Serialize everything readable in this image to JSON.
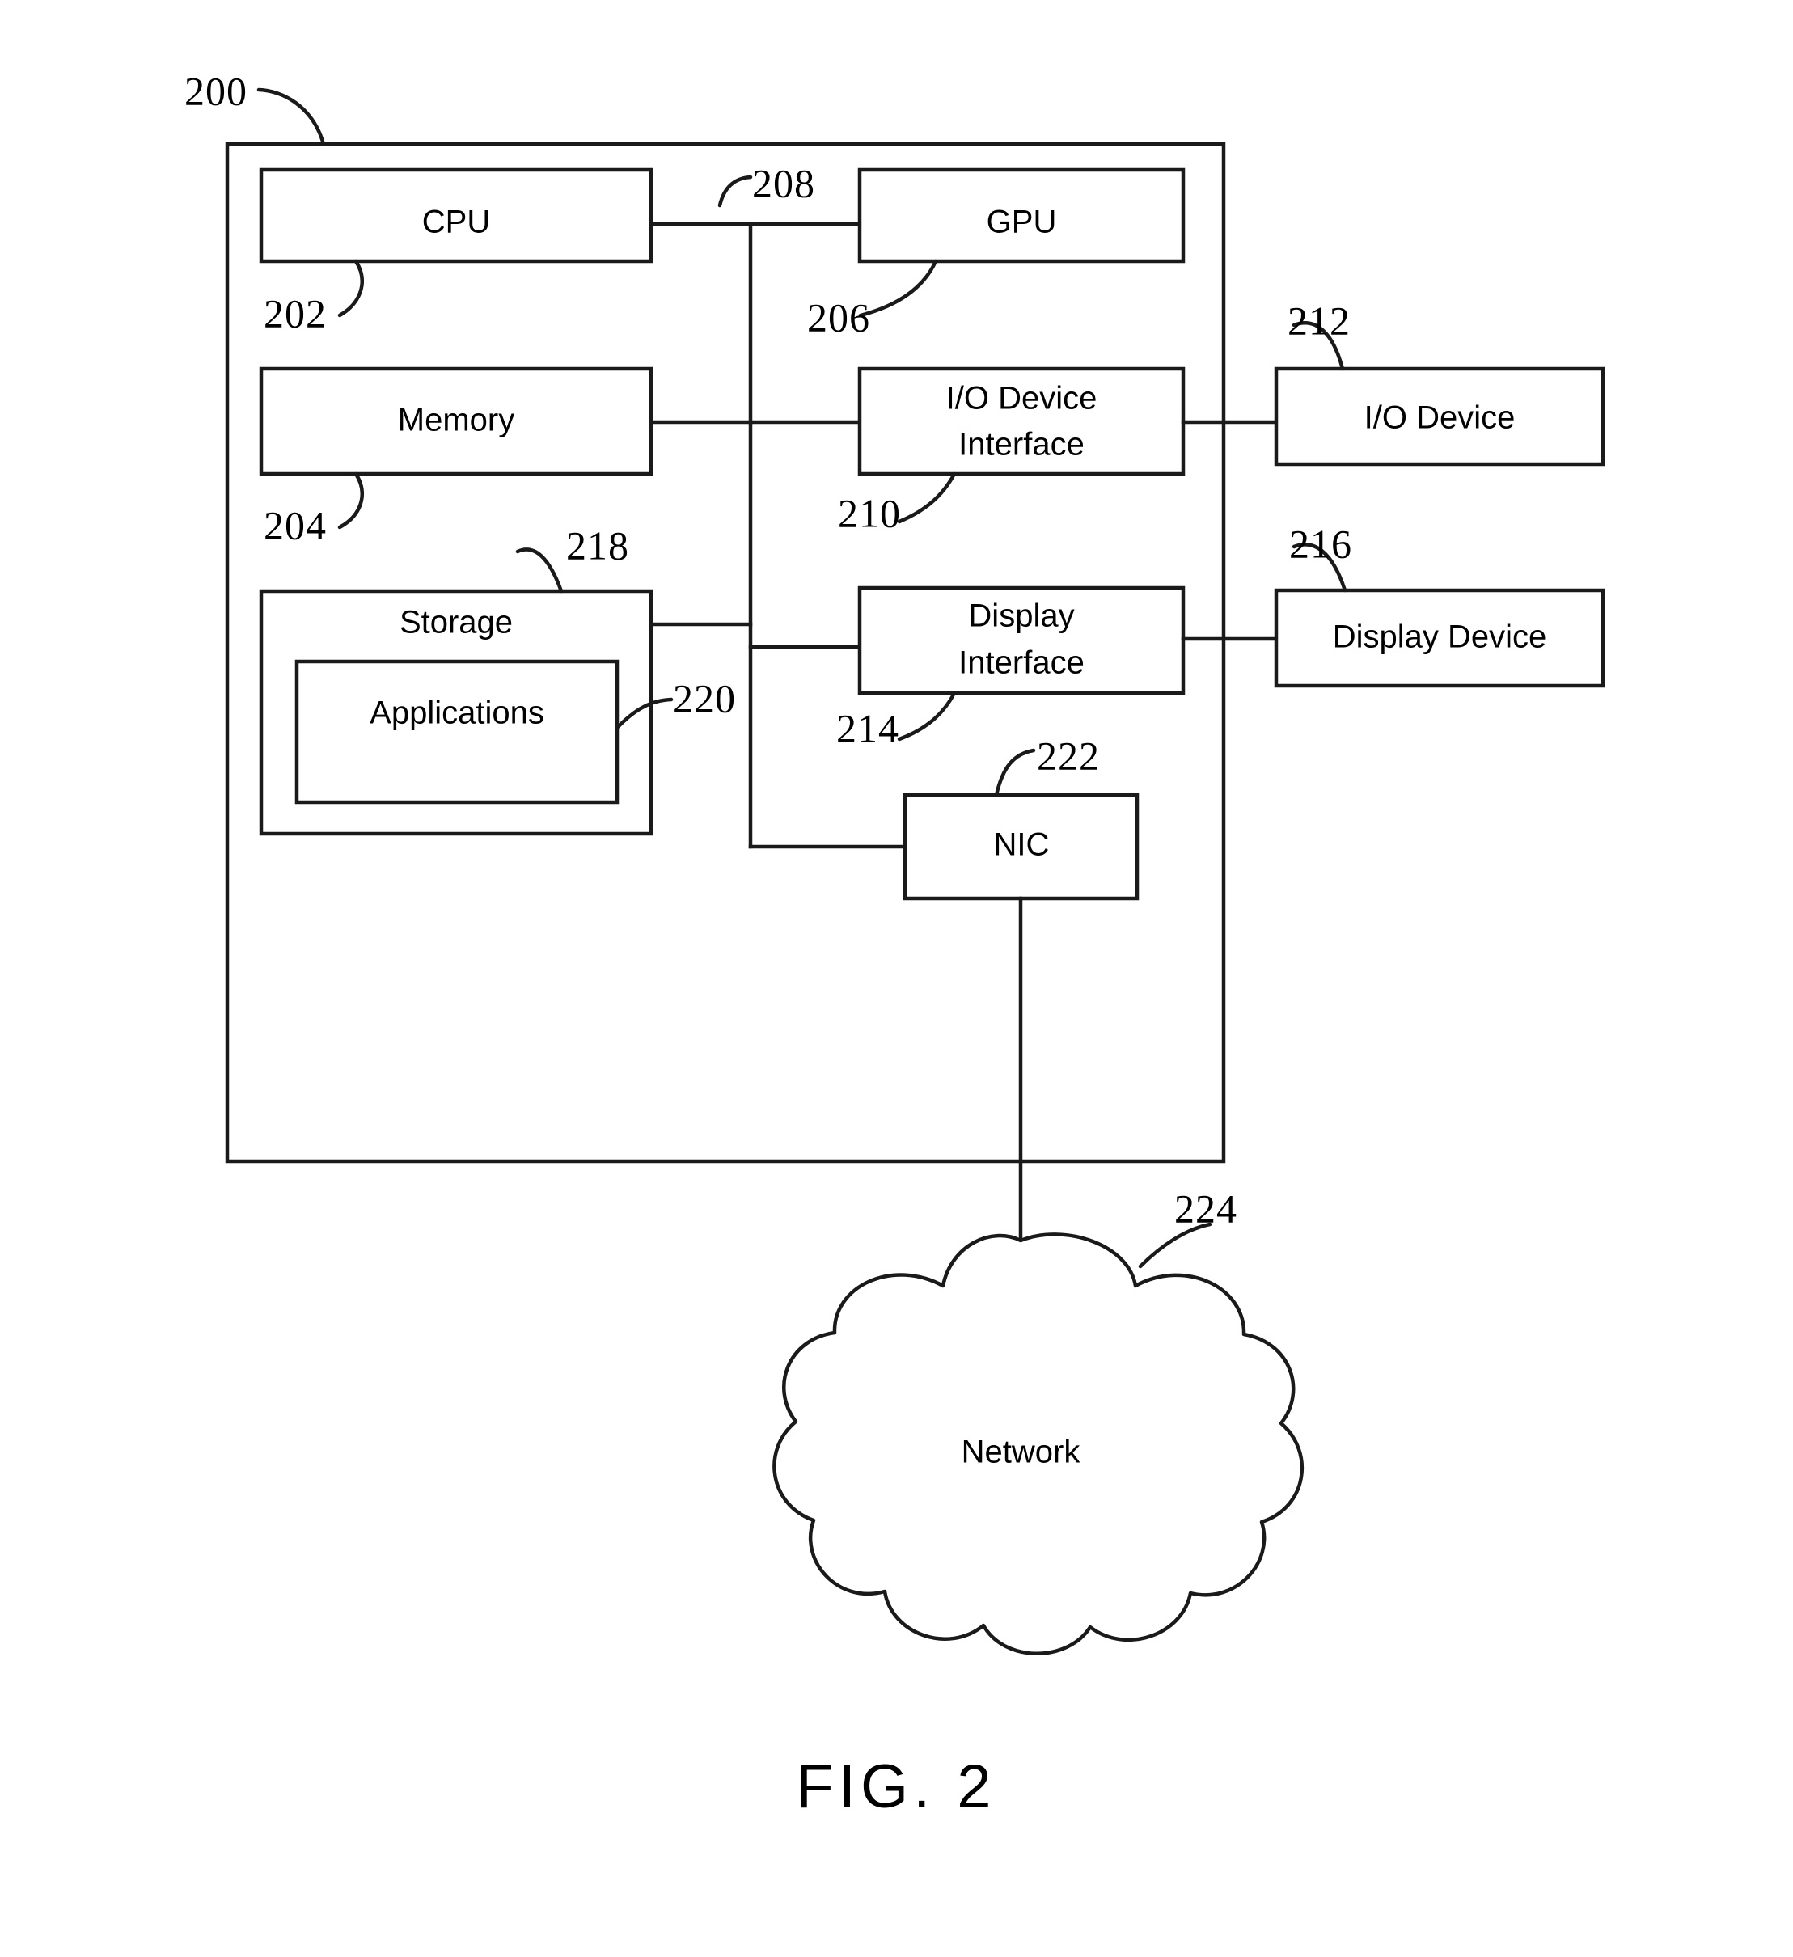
{
  "figure": {
    "caption": "FIG. 2",
    "system_ref": "200"
  },
  "nodes": [
    {
      "id": "cpu",
      "label": "CPU",
      "ref": "202",
      "line1": "CPU",
      "line2": ""
    },
    {
      "id": "gpu",
      "label": "GPU",
      "ref": "206",
      "line1": "GPU",
      "line2": ""
    },
    {
      "id": "memory",
      "label": "Memory",
      "ref": "204",
      "line1": "Memory",
      "line2": ""
    },
    {
      "id": "io-interface",
      "label": "I/O Device Interface",
      "ref": "210",
      "line1": "I/O Device",
      "line2": "Interface"
    },
    {
      "id": "io-device",
      "label": "I/O Device",
      "ref": "212",
      "line1": "I/O Device",
      "line2": ""
    },
    {
      "id": "storage",
      "label": "Storage",
      "ref": "218",
      "line1": "Storage",
      "line2": ""
    },
    {
      "id": "applications",
      "label": "Applications",
      "ref": "220",
      "line1": "Applications",
      "line2": ""
    },
    {
      "id": "display-interface",
      "label": "Display Interface",
      "ref": "214",
      "line1": "Display",
      "line2": "Interface"
    },
    {
      "id": "display-device",
      "label": "Display Device",
      "ref": "216",
      "line1": "Display Device",
      "line2": ""
    },
    {
      "id": "nic",
      "label": "NIC",
      "ref": "222",
      "line1": "NIC",
      "line2": ""
    },
    {
      "id": "network",
      "label": "Network",
      "ref": "224",
      "line1": "Network",
      "line2": ""
    }
  ],
  "bus": {
    "ref": "208",
    "label": "208"
  },
  "refs": {
    "system": "200",
    "cpu": "202",
    "memory": "204",
    "gpu": "206",
    "bus": "208",
    "io_interface": "210",
    "io_device": "212",
    "display_interface": "214",
    "display_device": "216",
    "storage": "218",
    "applications": "220",
    "nic": "222",
    "network": "224"
  },
  "colors": {
    "ink": "#1a1a1a",
    "paper": "#ffffff"
  }
}
